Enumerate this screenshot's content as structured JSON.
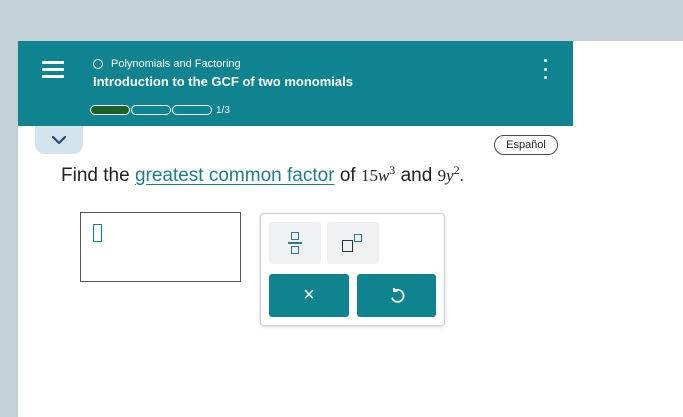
{
  "header": {
    "topic": "Polynomials and Factoring",
    "title": "Introduction to the GCF of two monomials",
    "progress": {
      "current": 1,
      "total": 3,
      "label": "1/3"
    },
    "accent_color": "#0f8390"
  },
  "language_button": "Español",
  "question": {
    "prefix": "Find the",
    "link_text": "greatest common factor",
    "middle": "of",
    "term1": {
      "coefficient": "15",
      "variable": "w",
      "exponent": "3"
    },
    "and": "and",
    "term2": {
      "coefficient": "9",
      "variable": "y",
      "exponent": "2"
    },
    "suffix": "."
  },
  "answer": {
    "value": ""
  },
  "keypad": {
    "keys": [
      "fraction-icon",
      "superscript-icon"
    ],
    "clear_label": "×",
    "undo_icon": "undo-icon"
  },
  "icons": {
    "menu": "hamburger-menu-icon",
    "more": "vertical-dots-icon",
    "collapse": "chevron-down-icon",
    "topic": "circle-icon"
  }
}
